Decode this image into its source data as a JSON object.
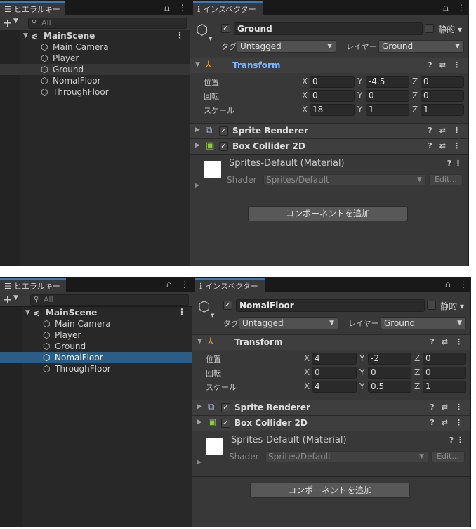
{
  "colors": {
    "accent": "#3a79bb",
    "selection": "#2c5d87",
    "transform_title": "#7ab3ff",
    "collider_icon": "#8ecb3c"
  },
  "shots": [
    {
      "hierarchy": {
        "tab_label": "ヒエラルキー",
        "add_label": "+",
        "search_placeholder": "All",
        "scene": "MainScene",
        "items": [
          "Main Camera",
          "Player",
          "Ground",
          "NomalFloor",
          "ThroughFloor"
        ]
      },
      "inspector": {
        "tab_label": "インスペクター",
        "object_name": "Ground",
        "static_label": "静的",
        "tag_label": "タグ",
        "tag_value": "Untagged",
        "layer_label": "レイヤー",
        "layer_value": "Ground",
        "transform": {
          "title": "Transform",
          "position_label": "位置",
          "rotation_label": "回転",
          "scale_label": "スケール",
          "position": [
            "0",
            "-4.5",
            "0"
          ],
          "rotation": [
            "0",
            "0",
            "0"
          ],
          "scale": [
            "18",
            "1",
            "1"
          ]
        },
        "sprite_renderer": "Sprite Renderer",
        "box_collider": "Box Collider 2D",
        "material": {
          "title": "Sprites-Default (Material)",
          "shader_label": "Shader",
          "shader_value": "Sprites/Default",
          "edit_label": "Edit..."
        },
        "add_component": "コンポーネントを追加"
      }
    },
    {
      "hierarchy": {
        "tab_label": "ヒエラルキー",
        "add_label": "+",
        "search_placeholder": "All",
        "scene": "MainScene",
        "items": [
          "Main Camera",
          "Player",
          "Ground",
          "NomalFloor",
          "ThroughFloor"
        ]
      },
      "inspector": {
        "tab_label": "インスペクター",
        "object_name": "NomalFloor",
        "static_label": "静的",
        "tag_label": "タグ",
        "tag_value": "Untagged",
        "layer_label": "レイヤー",
        "layer_value": "Ground",
        "transform": {
          "title": "Transform",
          "position_label": "位置",
          "rotation_label": "回転",
          "scale_label": "スケール",
          "position": [
            "4",
            "-2",
            "0"
          ],
          "rotation": [
            "0",
            "0",
            "0"
          ],
          "scale": [
            "4",
            "0.5",
            "1"
          ]
        },
        "sprite_renderer": "Sprite Renderer",
        "box_collider": "Box Collider 2D",
        "material": {
          "title": "Sprites-Default (Material)",
          "shader_label": "Shader",
          "shader_value": "Sprites/Default",
          "edit_label": "Edit..."
        },
        "add_component": "コンポーネントを追加"
      }
    }
  ],
  "axis_labels": [
    "X",
    "Y",
    "Z"
  ]
}
